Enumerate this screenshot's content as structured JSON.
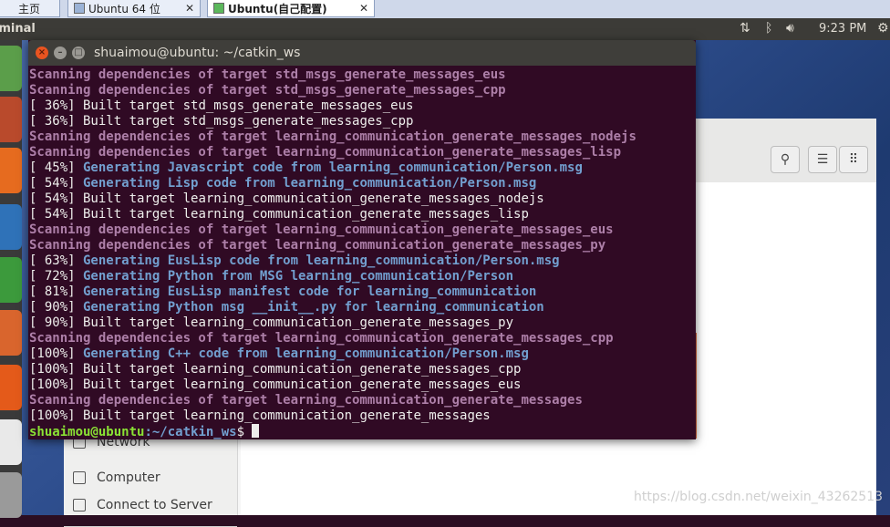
{
  "vm_tabs": [
    {
      "label": "主页"
    },
    {
      "label": "Ubuntu 64 位"
    },
    {
      "label": "Ubuntu(自己配置)"
    }
  ],
  "top_panel": {
    "app_name": "Terminal",
    "clock": "9:23 PM"
  },
  "nautilus": {
    "sidebar_items": [
      {
        "label": "Network"
      },
      {
        "label": "Computer"
      },
      {
        "label": "Connect to Server"
      }
    ]
  },
  "terminal": {
    "title": "shuaimou@ubuntu: ~/catkin_ws",
    "colors": {
      "background": "#300a24",
      "scanning": "#ad7fa8",
      "generating": "#729fcf",
      "default": "#eeeeec",
      "prompt_user": "#8ae234"
    },
    "lines": [
      {
        "type": "scanning",
        "text": "Scanning dependencies of target std_msgs_generate_messages_eus"
      },
      {
        "type": "scanning",
        "text": "Scanning dependencies of target std_msgs_generate_messages_cpp"
      },
      {
        "type": "built",
        "pct": "[ 36%]",
        "text": " Built target std_msgs_generate_messages_eus"
      },
      {
        "type": "built",
        "pct": "[ 36%]",
        "text": " Built target std_msgs_generate_messages_cpp"
      },
      {
        "type": "scanning",
        "text": "Scanning dependencies of target learning_communication_generate_messages_nodejs"
      },
      {
        "type": "scanning",
        "text": "Scanning dependencies of target learning_communication_generate_messages_lisp"
      },
      {
        "type": "generating",
        "pct": "[ 45%]",
        "text": " Generating Javascript code from learning_communication/Person.msg"
      },
      {
        "type": "generating",
        "pct": "[ 54%]",
        "text": " Generating Lisp code from learning_communication/Person.msg"
      },
      {
        "type": "built",
        "pct": "[ 54%]",
        "text": " Built target learning_communication_generate_messages_nodejs"
      },
      {
        "type": "built",
        "pct": "[ 54%]",
        "text": " Built target learning_communication_generate_messages_lisp"
      },
      {
        "type": "scanning",
        "text": "Scanning dependencies of target learning_communication_generate_messages_eus"
      },
      {
        "type": "scanning",
        "text": "Scanning dependencies of target learning_communication_generate_messages_py"
      },
      {
        "type": "generating",
        "pct": "[ 63%]",
        "text": " Generating EusLisp code from learning_communication/Person.msg"
      },
      {
        "type": "generating",
        "pct": "[ 72%]",
        "text": " Generating Python from MSG learning_communication/Person"
      },
      {
        "type": "generating",
        "pct": "[ 81%]",
        "text": " Generating EusLisp manifest code for learning_communication"
      },
      {
        "type": "generating",
        "pct": "[ 90%]",
        "text": " Generating Python msg __init__.py for learning_communication"
      },
      {
        "type": "built",
        "pct": "[ 90%]",
        "text": " Built target learning_communication_generate_messages_py"
      },
      {
        "type": "scanning",
        "text": "Scanning dependencies of target learning_communication_generate_messages_cpp"
      },
      {
        "type": "generating",
        "pct": "[100%]",
        "text": " Generating C++ code from learning_communication/Person.msg"
      },
      {
        "type": "built",
        "pct": "[100%]",
        "text": " Built target learning_communication_generate_messages_cpp"
      },
      {
        "type": "built",
        "pct": "[100%]",
        "text": " Built target learning_communication_generate_messages_eus"
      },
      {
        "type": "scanning",
        "text": "Scanning dependencies of target learning_communication_generate_messages"
      },
      {
        "type": "built",
        "pct": "[100%]",
        "text": " Built target learning_communication_generate_messages"
      }
    ],
    "prompt": {
      "user_host": "shuaimou@ubuntu",
      "path": ":~/catkin_ws",
      "symbol": "$ "
    }
  },
  "watermark": "https://blog.csdn.net/weixin_43262513"
}
